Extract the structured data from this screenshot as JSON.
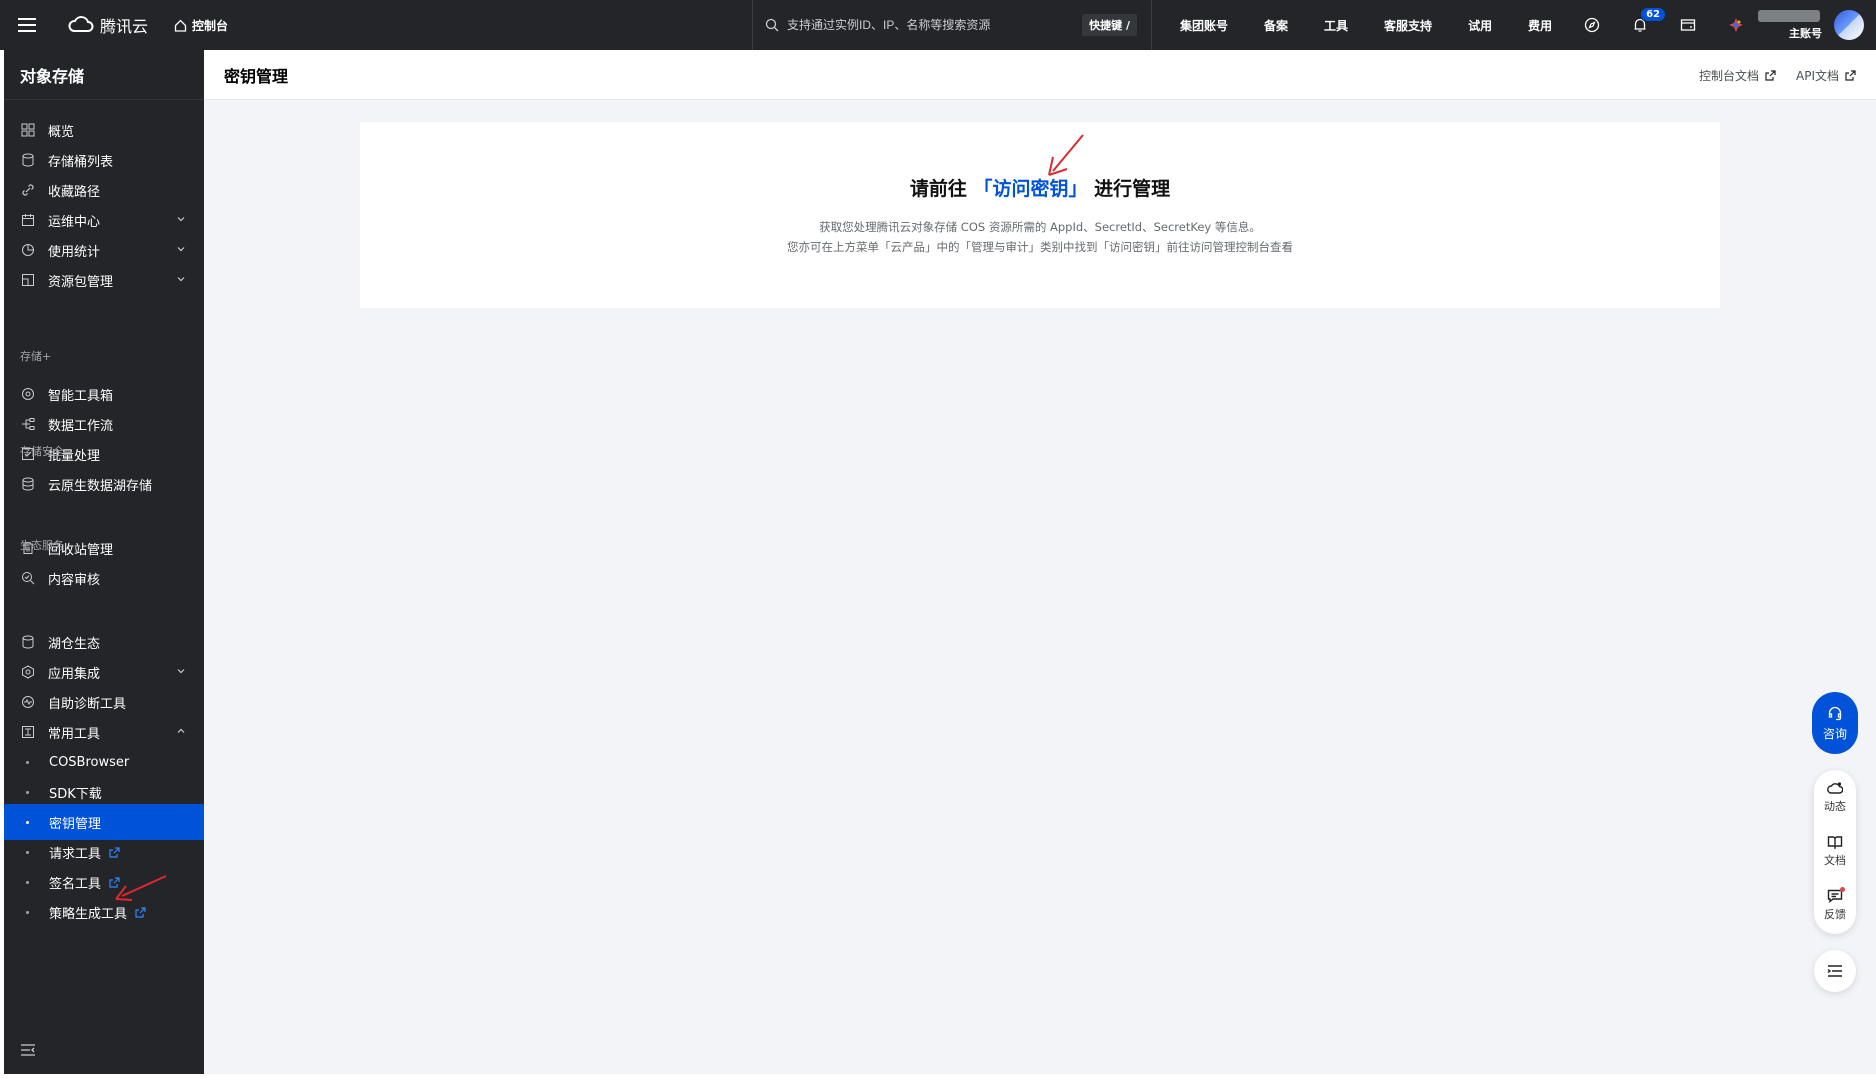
{
  "topbar": {
    "brand": "腾讯云",
    "console": "控制台",
    "search_placeholder": "支持通过实例ID、IP、名称等搜索资源",
    "shortcut": "快捷键 /",
    "links": [
      "集团账号",
      "备案",
      "工具",
      "客服支持",
      "试用",
      "费用"
    ],
    "notification_count": "62",
    "account_label": "主账号"
  },
  "sidebar": {
    "title": "对象存储",
    "items": [
      {
        "label": "概览",
        "icon": "grid-icon"
      },
      {
        "label": "存储桶列表",
        "icon": "bucket-icon"
      },
      {
        "label": "收藏路径",
        "icon": "link-icon"
      },
      {
        "label": "运维中心",
        "icon": "calendar-icon"
      },
      {
        "label": "使用统计",
        "icon": "pie-chart-icon"
      },
      {
        "label": "资源包管理",
        "icon": "package-icon"
      }
    ],
    "group_storage_plus": "存储+",
    "items_plus": [
      {
        "label": "智能工具箱",
        "icon": "toolbox-icon"
      },
      {
        "label": "数据工作流",
        "icon": "workflow-icon"
      },
      {
        "label": "批量处理",
        "icon": "batch-icon"
      },
      {
        "label": "云原生数据湖存储",
        "icon": "datalake-icon"
      }
    ],
    "group_security": "存储安全",
    "items_security": [
      {
        "label": "回收站管理",
        "icon": "trash-icon"
      },
      {
        "label": "内容审核",
        "icon": "audit-icon"
      }
    ],
    "group_eco": "生态服务",
    "items_eco": [
      {
        "label": "湖仓生态",
        "icon": "lakehouse-icon"
      },
      {
        "label": "应用集成",
        "icon": "integration-icon"
      },
      {
        "label": "自助诊断工具",
        "icon": "diagnose-icon"
      },
      {
        "label": "常用工具",
        "icon": "tools-icon"
      }
    ],
    "sub_items": [
      {
        "label": "COSBrowser"
      },
      {
        "label": "SDK下载"
      },
      {
        "label": "密钥管理"
      },
      {
        "label": "请求工具"
      },
      {
        "label": "签名工具"
      },
      {
        "label": "策略生成工具"
      }
    ]
  },
  "main": {
    "page_title": "密钥管理",
    "doc_links": [
      "控制台文档",
      "API文档"
    ],
    "headline_prefix": "请前往",
    "headline_link": "「访问密钥」",
    "headline_suffix": "进行管理",
    "desc_line1": "获取您处理腾讯云对象存储 COS 资源所需的 AppId、SecretId、SecretKey 等信息。",
    "desc_line2": "您亦可在上方菜单「云产品」中的「管理与审计」类别中找到「访问密钥」前往访问管理控制台查看"
  },
  "floating": {
    "consult": "咨询",
    "panel": [
      "动态",
      "文档",
      "反馈"
    ]
  },
  "colors": {
    "topbar_bg": "#232529",
    "sidebar_bg": "#232529",
    "accent": "#0052d9",
    "annotation_red": "#e0282e"
  }
}
